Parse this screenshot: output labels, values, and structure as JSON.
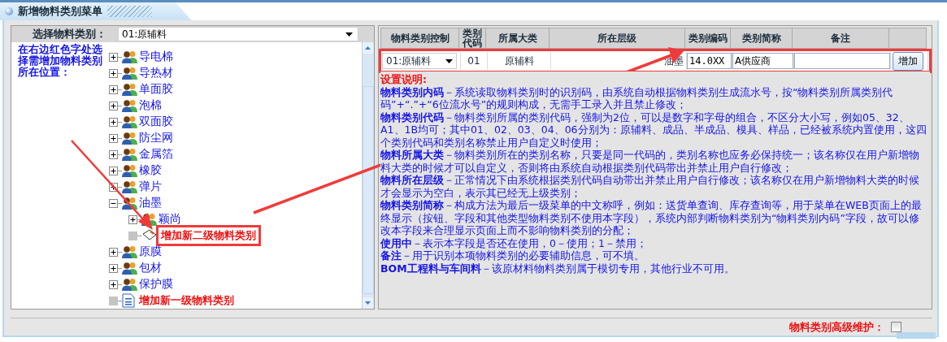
{
  "window": {
    "title": "新增物料类别菜单"
  },
  "left_panel": {
    "select_label": "选择物料类别：",
    "select_value": "01:原辅料",
    "instruction": "在右边红色字处选择需增加物料类别所在位置：",
    "tree": [
      {
        "kind": "category",
        "label": "导电棉",
        "expanded": false
      },
      {
        "kind": "category",
        "label": "导热材",
        "expanded": false
      },
      {
        "kind": "category",
        "label": "单面胶",
        "expanded": false
      },
      {
        "kind": "category",
        "label": "泡棉",
        "expanded": false
      },
      {
        "kind": "category",
        "label": "双面胶",
        "expanded": false
      },
      {
        "kind": "category",
        "label": "防尘网",
        "expanded": false
      },
      {
        "kind": "category",
        "label": "金属箔",
        "expanded": false
      },
      {
        "kind": "category",
        "label": "橡胶",
        "expanded": false
      },
      {
        "kind": "category",
        "label": "弹片",
        "expanded": false
      },
      {
        "kind": "category",
        "label": "油墨",
        "expanded": true,
        "children": [
          {
            "kind": "category",
            "label": "颖尚",
            "expanded": false
          },
          {
            "kind": "add",
            "label": "增加新二级物料类别",
            "highlighted": true
          }
        ]
      },
      {
        "kind": "category",
        "label": "原膜",
        "expanded": false
      },
      {
        "kind": "category",
        "label": "包材",
        "expanded": false
      },
      {
        "kind": "category",
        "label": "保护膜",
        "expanded": false
      },
      {
        "kind": "add",
        "label": "增加新一级物料类别",
        "highlighted": false
      }
    ]
  },
  "right_panel": {
    "columns": [
      "物料类别控制",
      "类别代码",
      "所属大类",
      "所在层级",
      "类别编码",
      "类别简称",
      "备注"
    ],
    "entry_row": {
      "highlighted": true,
      "control": "01:原辅料",
      "code": "01",
      "main_class": "原辅料",
      "level": "油墨",
      "class_code": "14.0XX",
      "short_name": "A供应商",
      "button": "增加"
    },
    "notes_title": "设置说明:",
    "notes": [
      "**物料类别内码**－系统读取物料类别时的识别码，由系统自动根据物料类别生成流水号，按“物料类别所属类别代码”+“.”+“6位流水号”的规则构成，无需手工录入并且禁止修改；",
      "**物料类别代码**－物料类别所属的类别代码，强制为2位，可以是数字和字母的组合，不区分大小写，例如05、32、A1、1B均可；其中01、02、03、04、06分别为：原辅料、成品、半成品、模具、样品，已经被系统内置使用，这四个类别代码和类别名称禁止用户自定义时使用；",
      "**物料所属大类**－物料类别所在的类别名称，只要是同一代码的，类别名称也应务必保持统一；该名称仅在用户新增物料大类的时候才可以自定义，否则将由系统自动根据类别代码带出并禁止用户自行修改；",
      "**物料所在层级**－正常情况下由系统根据类别代码自动带出并禁止用户自行修改；该名称仅在用户新增物料大类的时候才会显示为空白，表示其已经无上级类别；",
      "**物料类别简称**－构成方法为最后一级菜单的中文称呼，例如：送货单查询、库存查询等，用于菜单在WEB页面上的最终显示（按钮、字段和其他类型物料类别不使用本字段），系统内部判断物料类别为“物料类别内码”字段，故可以修改本字段来合理显示页面上而不影响物料类别的分配；",
      "**使用中**－表示本字段是否还在使用，0－使用；1－禁用；",
      "**备注**－用于识别本项物料类别的必要辅助信息，可不填。",
      "**BOM工程料与车间料**－该原材料物料类别属于模切专用，其他行业不可用。"
    ]
  },
  "advanced": {
    "label": "物料类别高级维护：",
    "checked": false
  }
}
